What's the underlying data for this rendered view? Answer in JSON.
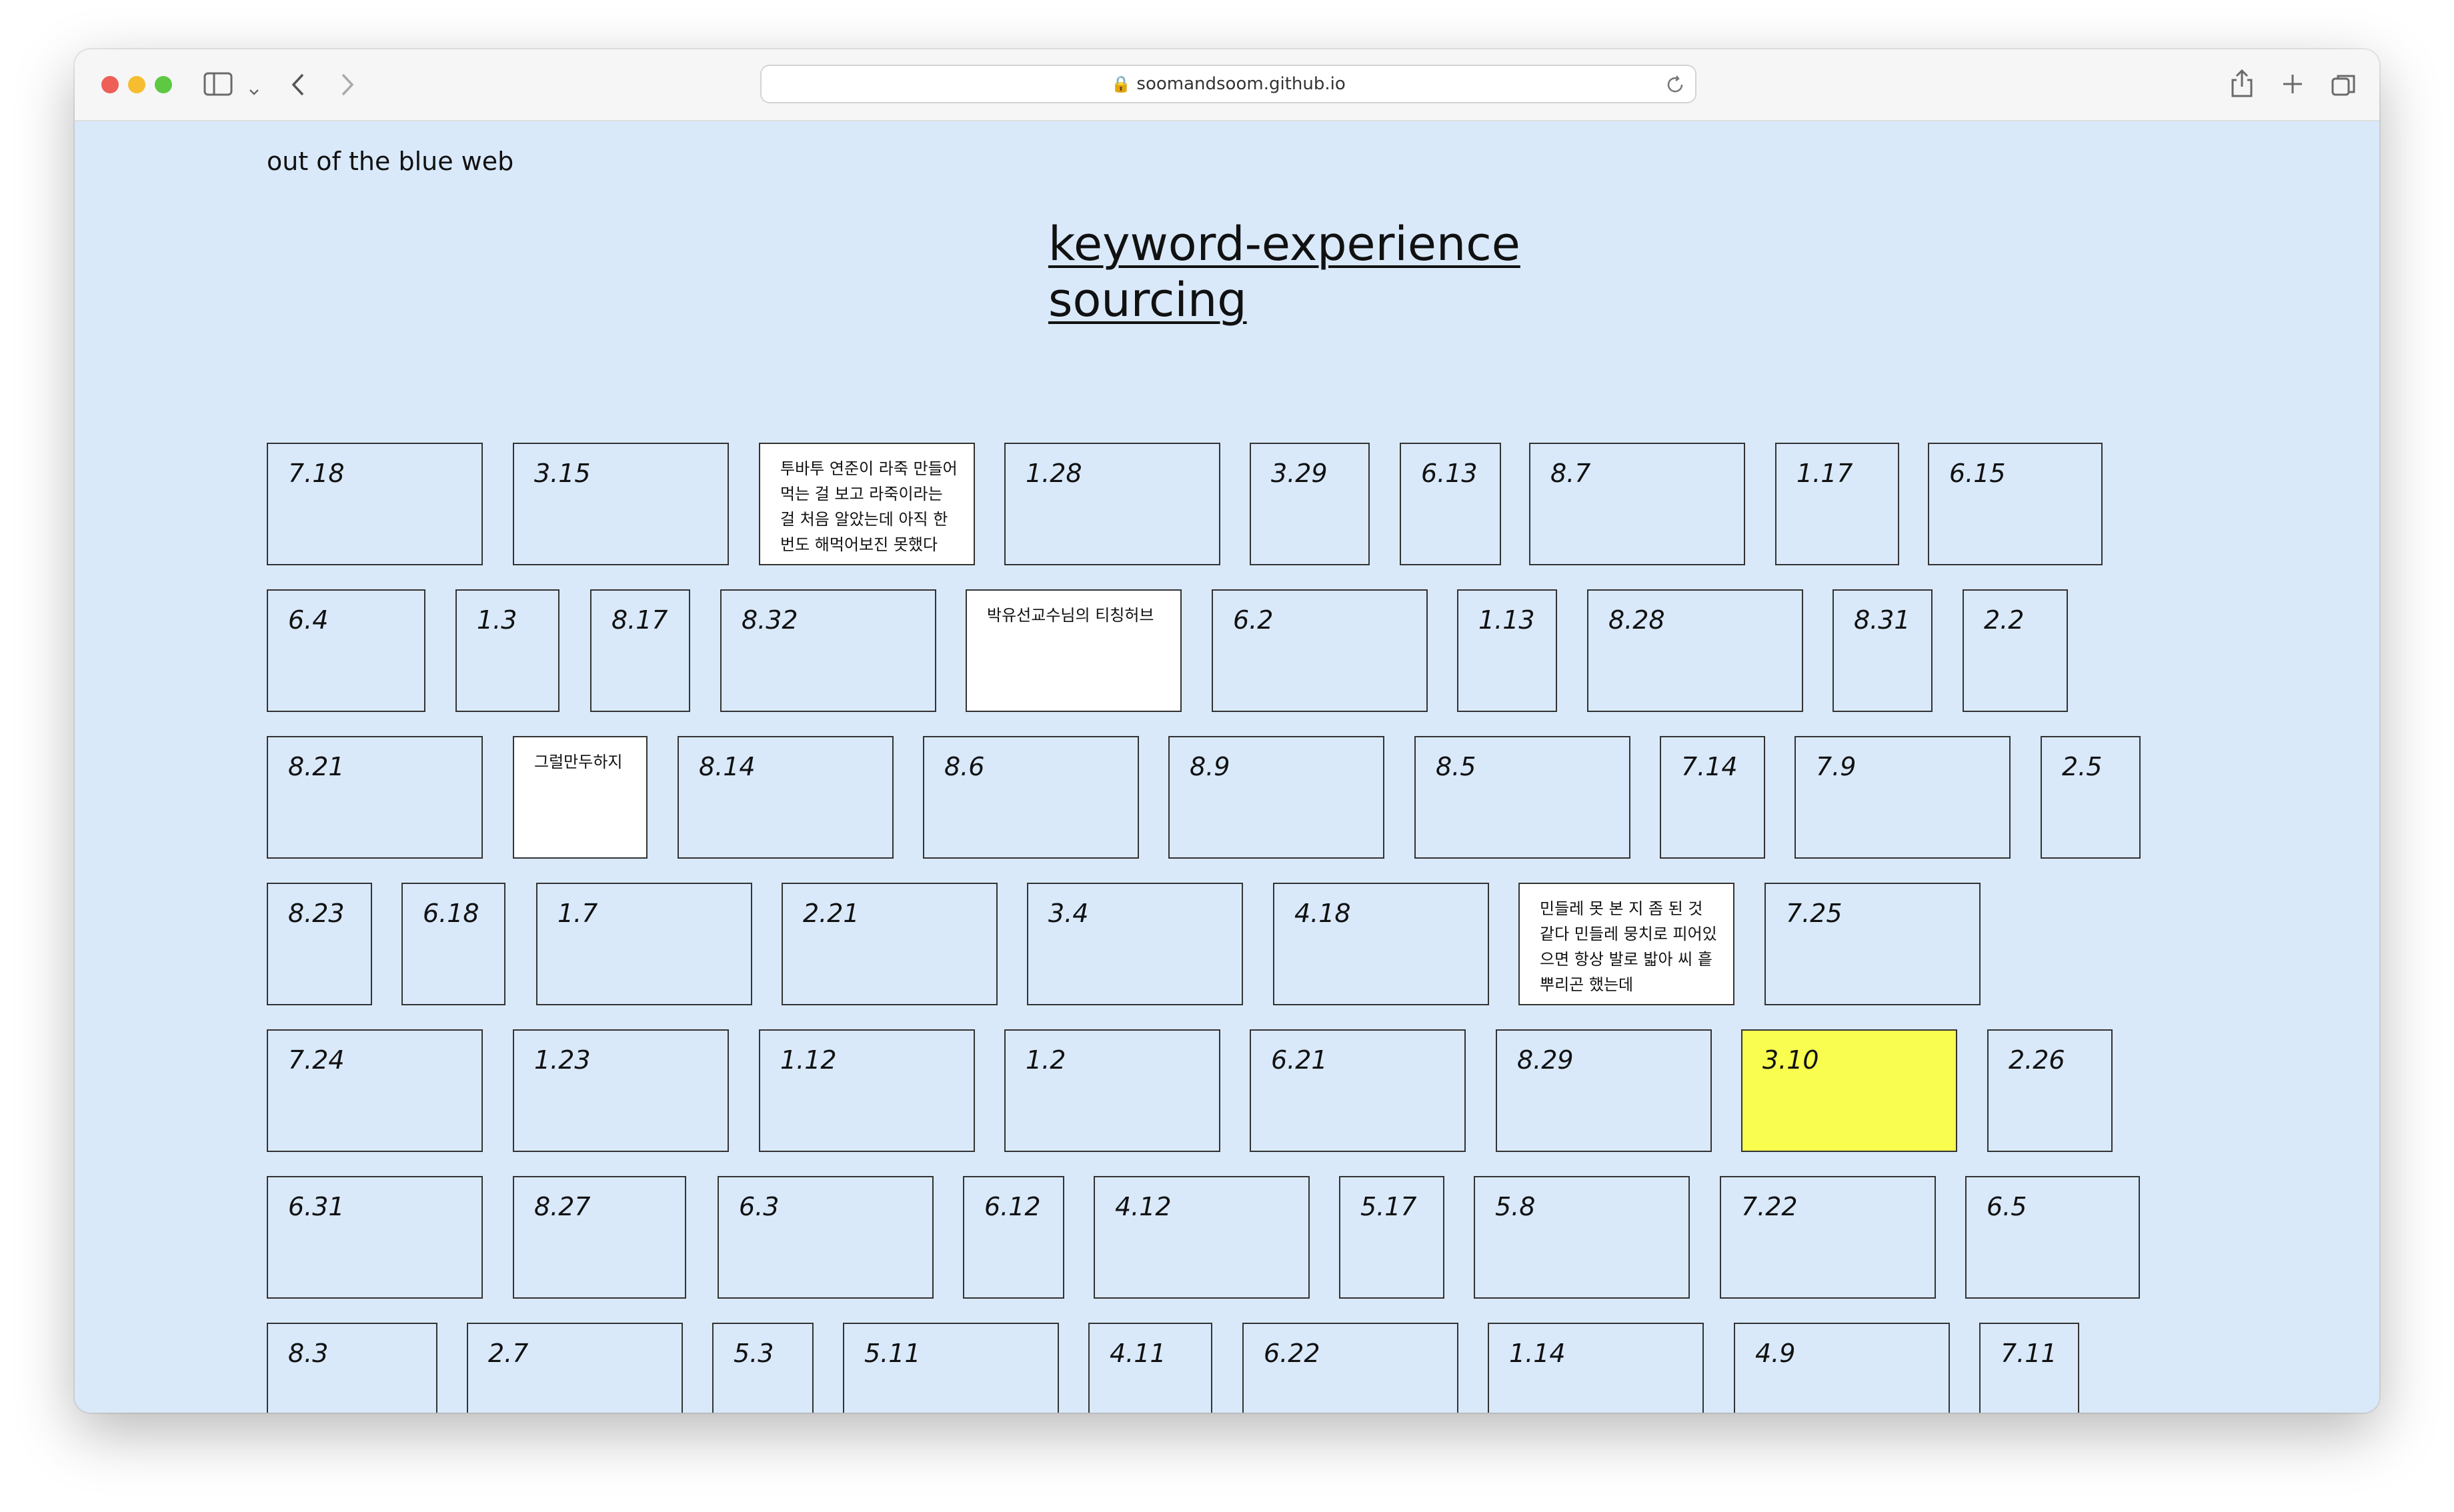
{
  "browser": {
    "url": "soomandsoom.github.io",
    "traffic_colors": {
      "close": "#ed5f57",
      "minimize": "#f5bd2f",
      "maximize": "#5fc843"
    }
  },
  "site": {
    "name": "out of the blue web",
    "title": "keyword-experience sourcing"
  },
  "tiles": [
    {
      "text": "7.18"
    },
    {
      "text": "3.15"
    },
    {
      "text": "투바투 연준이 라죽 만들어 먹는 걸 보고 라죽이라는 걸 처음 알았는데 아직 한번도 해먹어보진 못했다",
      "note": true
    },
    {
      "text": "1.28"
    },
    {
      "text": "3.29"
    },
    {
      "text": "6.13"
    },
    {
      "text": "8.7"
    },
    {
      "text": "1.17"
    },
    {
      "text": "6.15"
    },
    {
      "text": "6.4"
    },
    {
      "text": "1.3"
    },
    {
      "text": "8.17"
    },
    {
      "text": "8.32"
    },
    {
      "text": "박유선교수님의 티칭허브",
      "note": true
    },
    {
      "text": "6.2"
    },
    {
      "text": "1.13"
    },
    {
      "text": "8.28"
    },
    {
      "text": "8.31"
    },
    {
      "text": "2.2"
    },
    {
      "text": "8.21"
    },
    {
      "text": "그럴만두하지",
      "note": true
    },
    {
      "text": "8.14"
    },
    {
      "text": "8.6"
    },
    {
      "text": "8.9"
    },
    {
      "text": "8.5"
    },
    {
      "text": "7.14"
    },
    {
      "text": "7.9"
    },
    {
      "text": "2.5"
    },
    {
      "text": "8.23"
    },
    {
      "text": "6.18"
    },
    {
      "text": "1.7"
    },
    {
      "text": "2.21"
    },
    {
      "text": "3.4"
    },
    {
      "text": "4.18"
    },
    {
      "text": "민들레 못 본 지 좀 된 것 같다 민들레 뭉치로 피어있으면 항상 발로 밟아 씨 흩뿌리곤 했는데",
      "note": true
    },
    {
      "text": "7.25"
    },
    {
      "text": "7.24"
    },
    {
      "text": "1.23"
    },
    {
      "text": "1.12"
    },
    {
      "text": "1.2"
    },
    {
      "text": "6.21"
    },
    {
      "text": "8.29"
    },
    {
      "text": "3.10",
      "highlight": true
    },
    {
      "text": "2.26"
    },
    {
      "text": "6.31"
    },
    {
      "text": "8.27"
    },
    {
      "text": "6.3"
    },
    {
      "text": "6.12"
    },
    {
      "text": "4.12"
    },
    {
      "text": "5.17"
    },
    {
      "text": "5.8"
    },
    {
      "text": "7.22"
    },
    {
      "text": "6.5"
    },
    {
      "text": "8.3"
    },
    {
      "text": "2.7"
    },
    {
      "text": "5.3"
    },
    {
      "text": "5.11"
    },
    {
      "text": "4.11"
    },
    {
      "text": "6.22"
    },
    {
      "text": "1.14"
    },
    {
      "text": "4.9"
    },
    {
      "text": "7.11"
    }
  ]
}
